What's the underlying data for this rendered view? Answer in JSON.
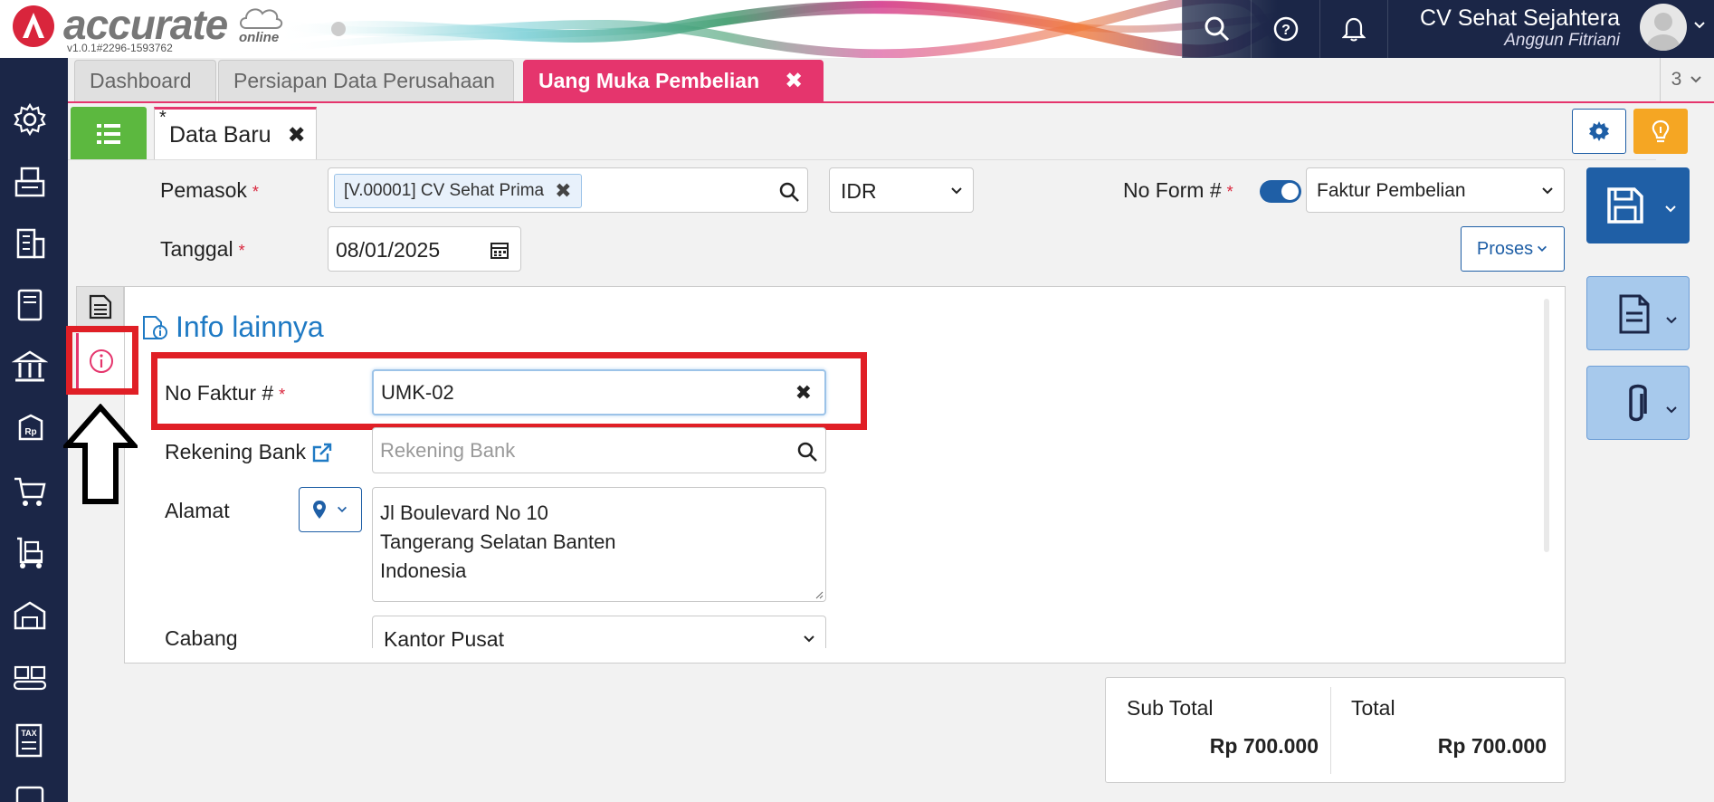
{
  "header": {
    "logo_text": "accurate",
    "logo_sub": "online",
    "version": "v1.0.1#2296-1593762",
    "company": "CV Sehat Sejahtera",
    "user": "Anggun Fitriani"
  },
  "tabs": [
    {
      "label": "Dashboard"
    },
    {
      "label": "Persiapan Data Perusahaan"
    },
    {
      "label": "Uang Muka Pembelian",
      "close": "✖"
    }
  ],
  "tab_count": "3",
  "doc_tab": {
    "marker": "*",
    "label": "Data Baru",
    "close": "✖"
  },
  "form": {
    "pemasok_label": "Pemasok",
    "pemasok_value": "[V.00001] CV Sehat Prima",
    "pemasok_clear": "✖",
    "currency": "IDR",
    "no_form_label": "No Form #",
    "no_form_value": "Faktur Pembelian",
    "tanggal_label": "Tanggal",
    "tanggal_value": "08/01/2025",
    "proses_label": "Proses",
    "required_mark": "*"
  },
  "info": {
    "title": "Info lainnya",
    "no_faktur_label": "No Faktur #",
    "no_faktur_value": "UMK-02",
    "no_faktur_clear": "✖",
    "rekening_label": "Rekening Bank",
    "rekening_placeholder": "Rekening Bank",
    "alamat_label": "Alamat",
    "alamat_lines": [
      "Jl Boulevard No 10",
      "Tangerang Selatan Banten",
      "Indonesia"
    ],
    "cabang_label": "Cabang",
    "cabang_value": "Kantor Pusat"
  },
  "totals": {
    "subtotal_label": "Sub Total",
    "subtotal_value": "Rp 700.000",
    "total_label": "Total",
    "total_value": "Rp 700.000"
  },
  "colors": {
    "nav_bg": "#1b2647",
    "accent_pink": "#e5356d",
    "primary_blue": "#1f5fa6",
    "green": "#5cb83f",
    "annotation_red": "#e01f26"
  }
}
